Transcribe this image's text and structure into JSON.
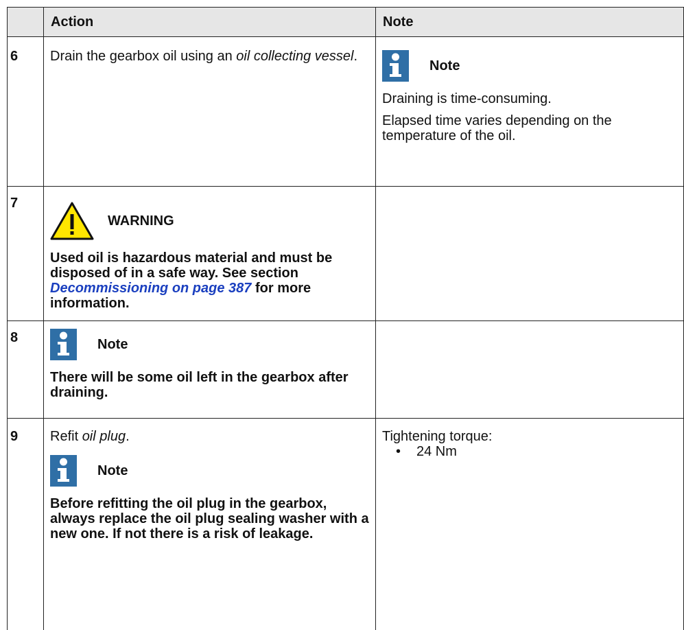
{
  "header": {
    "action_label": "Action",
    "note_label": "Note"
  },
  "rows": [
    {
      "number": "6",
      "action_text_1": "Drain the gearbox oil using an ",
      "action_em": "oil collecting vessel",
      "action_text_2": ".",
      "note_icon_label": "Note",
      "note_line_1": "Draining is time-consuming.",
      "note_line_2": "Elapsed time varies depending on the temperature of the oil."
    },
    {
      "number": "7",
      "warning_label": "WARNING",
      "warning_text_1": "Used oil is hazardous material and must be disposed of in a safe way. See section ",
      "warning_link": "Decommissioning on page 387",
      "warning_text_2": " for more information."
    },
    {
      "number": "8",
      "note_icon_label": "Note",
      "note_text": "There will be some oil left in the gearbox after draining."
    },
    {
      "number": "9",
      "action_text_1": "Refit ",
      "action_em": "oil plug",
      "action_text_2": ".",
      "note_icon_label": "Note",
      "note_text": "Before refitting the oil plug in the gearbox, always replace the oil plug sealing washer with a new one. If not there is a risk of leakage.",
      "torque_label": "Tightening torque:",
      "torque_value": "24 Nm"
    }
  ],
  "colors": {
    "header_bg": "#e6e6e6",
    "info_icon_blue": "#2f6fa6",
    "warning_yellow": "#ffe600",
    "link_blue": "#1a3fbf"
  },
  "icons": [
    "info-icon",
    "warning-icon"
  ]
}
